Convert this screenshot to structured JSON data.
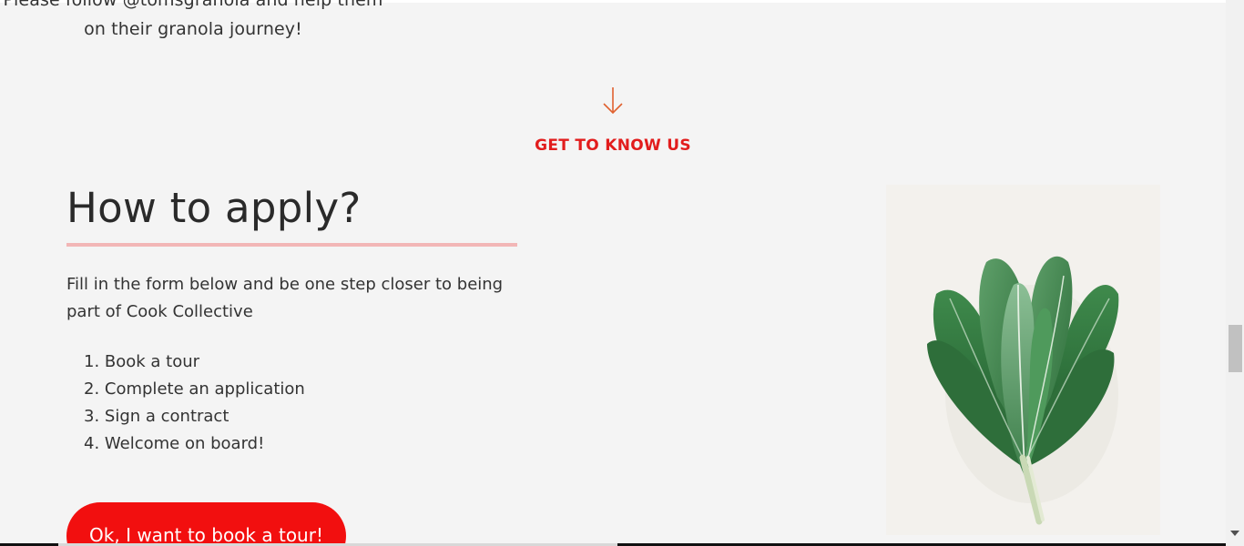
{
  "follow": {
    "line1": "Please follow @tomsgranola and help them",
    "line2": "on their granola journey!"
  },
  "section": {
    "link_label": "GET TO KNOW US",
    "arrow_icon": "arrow-down-icon"
  },
  "apply": {
    "title": "How to apply?",
    "intro": "Fill in the form below and be one step closer to being part of Cook Collective",
    "steps": [
      "1. Book a tour",
      "2. Complete an application",
      "3. Sign a contract",
      "4. Welcome on board!"
    ],
    "cta_label": "Ok, I want to book a tour!"
  },
  "image": {
    "subject": "kale-leaves-image"
  },
  "colors": {
    "accent_red": "#e21d1d",
    "button_red": "#f20f0f",
    "underline_pink": "#f2b6b6",
    "arrow_orange": "#e0612f",
    "background": "#f4f4f4"
  }
}
